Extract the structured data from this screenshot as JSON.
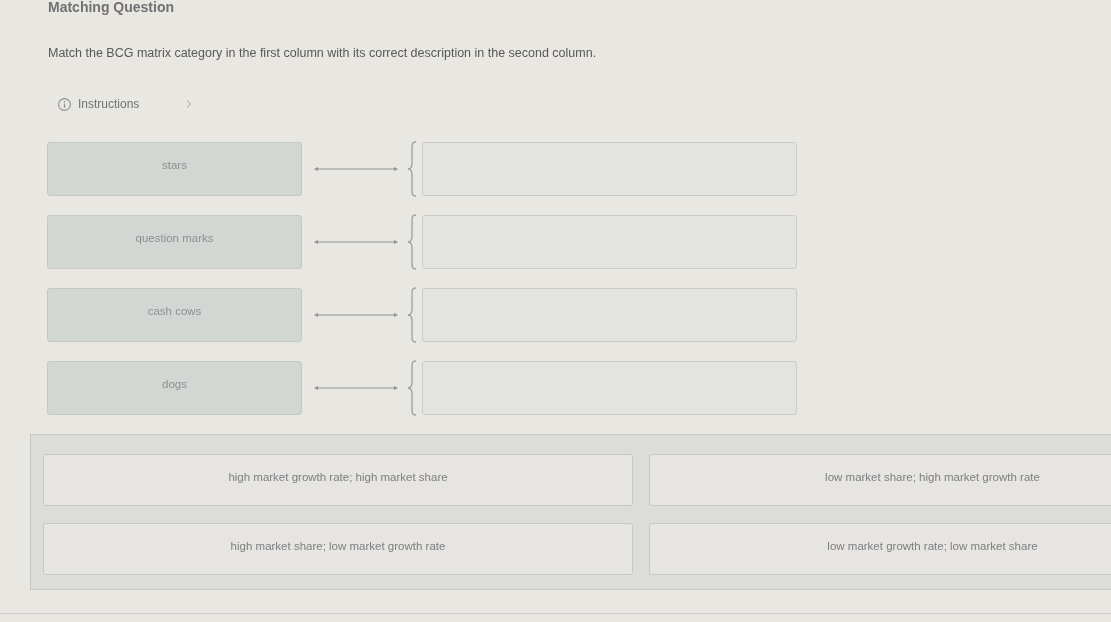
{
  "title": "Matching Question",
  "prompt": "Match the BCG matrix category in the first column with its correct description in the second column.",
  "instructions": {
    "label": "Instructions",
    "expanded": false
  },
  "premises": [
    {
      "label": "stars"
    },
    {
      "label": "question marks"
    },
    {
      "label": "cash cows"
    },
    {
      "label": "dogs"
    }
  ],
  "answer_bank": [
    {
      "text": "high market growth rate; high market share"
    },
    {
      "text": "low market share; high market growth rate"
    },
    {
      "text": "high market share; low market growth rate"
    },
    {
      "text": "low market growth rate; low market share"
    }
  ]
}
